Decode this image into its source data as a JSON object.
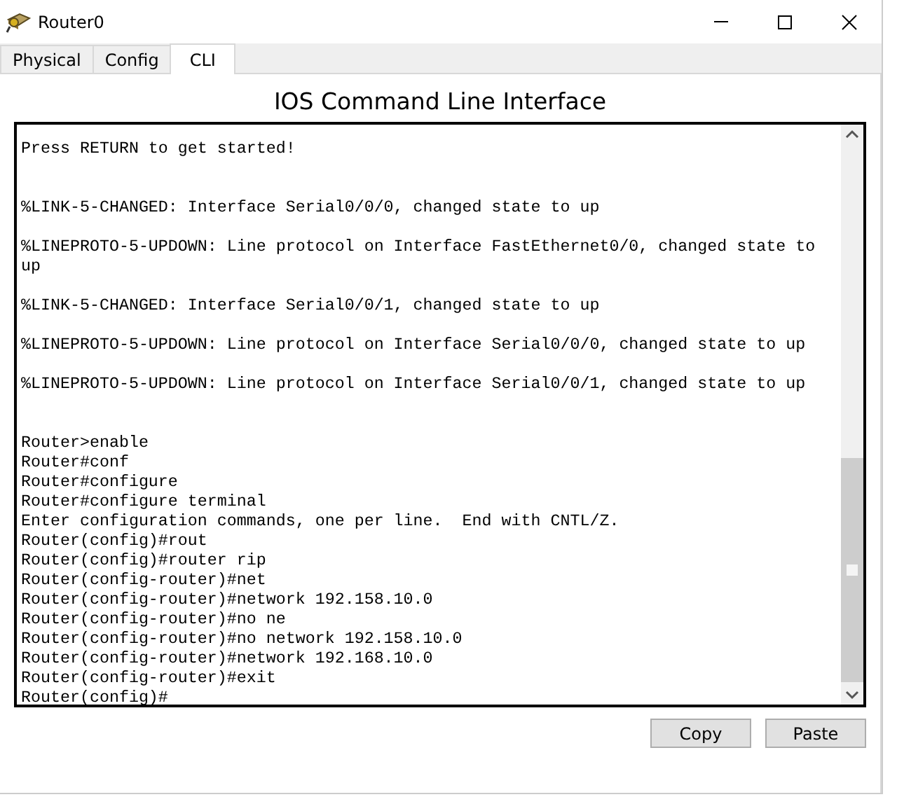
{
  "window": {
    "title": "Router0"
  },
  "tabs": [
    {
      "label": "Physical",
      "selected": false
    },
    {
      "label": "Config",
      "selected": false
    },
    {
      "label": "CLI",
      "selected": true
    }
  ],
  "heading": "IOS Command Line Interface",
  "terminal": {
    "lines": [
      {
        "kind": "line",
        "text": "Press RETURN to get started!"
      },
      {
        "kind": "break",
        "text": "%LINK-5-CHANGED: Interface Serial0/0/0, changed state to up"
      },
      {
        "kind": "event",
        "text": "%LINEPROTO-5-UPDOWN: Line protocol on Interface FastEthernet0/0, changed state to up"
      },
      {
        "kind": "event",
        "text": "%LINK-5-CHANGED: Interface Serial0/0/1, changed state to up"
      },
      {
        "kind": "event",
        "text": "%LINEPROTO-5-UPDOWN: Line protocol on Interface Serial0/0/0, changed state to up"
      },
      {
        "kind": "event",
        "text": "%LINEPROTO-5-UPDOWN: Line protocol on Interface Serial0/0/1, changed state to up"
      },
      {
        "kind": "break",
        "text": "Router>enable"
      },
      {
        "kind": "line",
        "text": "Router#conf"
      },
      {
        "kind": "line",
        "text": "Router#configure"
      },
      {
        "kind": "line",
        "text": "Router#configure terminal"
      },
      {
        "kind": "line",
        "text": "Enter configuration commands, one per line.  End with CNTL/Z."
      },
      {
        "kind": "line",
        "text": "Router(config)#rout"
      },
      {
        "kind": "line",
        "text": "Router(config)#router rip"
      },
      {
        "kind": "line",
        "text": "Router(config-router)#net"
      },
      {
        "kind": "line",
        "text": "Router(config-router)#network 192.158.10.0"
      },
      {
        "kind": "line",
        "text": "Router(config-router)#no ne"
      },
      {
        "kind": "line",
        "text": "Router(config-router)#no network 192.158.10.0"
      },
      {
        "kind": "line",
        "text": "Router(config-router)#network 192.168.10.0"
      },
      {
        "kind": "line",
        "text": "Router(config-router)#exit"
      },
      {
        "kind": "input",
        "text": "Router(config)#"
      }
    ]
  },
  "buttons": [
    "Copy",
    "Paste"
  ]
}
